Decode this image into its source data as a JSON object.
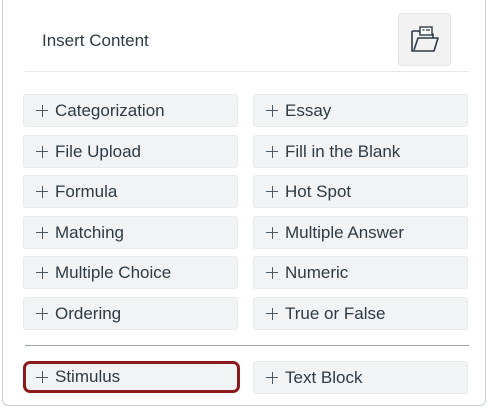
{
  "header": {
    "title": "Insert Content",
    "open_icon": "folder-open-icon"
  },
  "colors": {
    "selected_border": "#8b1a1a",
    "item_background": "#f2f3f4",
    "text": "#2d3b45"
  },
  "items": [
    {
      "label": "Categorization"
    },
    {
      "label": "Essay"
    },
    {
      "label": "File Upload"
    },
    {
      "label": "Fill in the Blank"
    },
    {
      "label": "Formula"
    },
    {
      "label": "Hot Spot"
    },
    {
      "label": "Matching"
    },
    {
      "label": "Multiple Answer"
    },
    {
      "label": "Multiple Choice"
    },
    {
      "label": "Numeric"
    },
    {
      "label": "Ordering"
    },
    {
      "label": "True or False"
    }
  ],
  "extra_items": [
    {
      "label": "Stimulus",
      "selected": true
    },
    {
      "label": "Text Block",
      "selected": false
    }
  ]
}
